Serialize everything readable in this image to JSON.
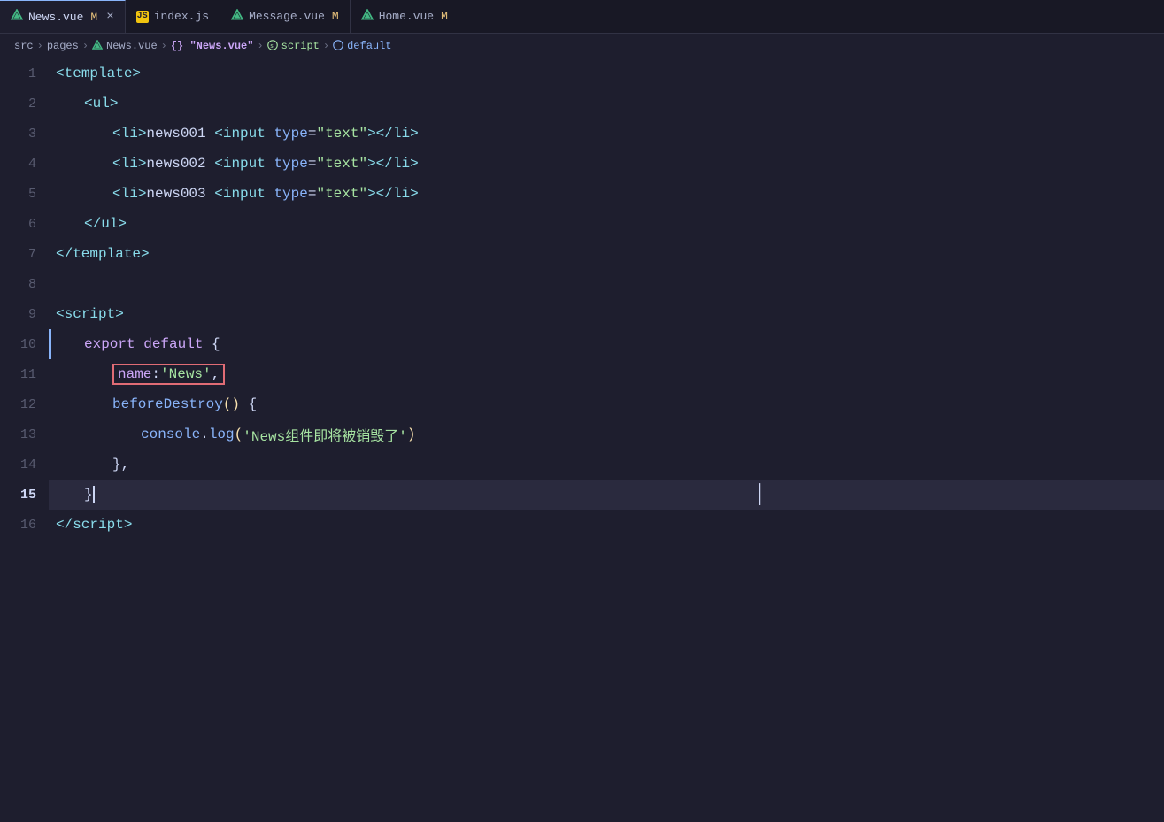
{
  "tabs": [
    {
      "id": "news-vue",
      "label": "News.vue",
      "type": "vue",
      "modified": "M",
      "active": true,
      "hasClose": true
    },
    {
      "id": "index-js",
      "label": "index.js",
      "type": "js",
      "modified": "",
      "active": false,
      "hasClose": false
    },
    {
      "id": "message-vue",
      "label": "Message.vue",
      "type": "vue",
      "modified": "M",
      "active": false,
      "hasClose": false
    },
    {
      "id": "home-vue",
      "label": "Home.vue",
      "type": "vue",
      "modified": "M",
      "active": false,
      "hasClose": false
    }
  ],
  "breadcrumb": {
    "parts": [
      {
        "text": "src",
        "type": "plain"
      },
      {
        "text": ">",
        "type": "sep"
      },
      {
        "text": "pages",
        "type": "plain"
      },
      {
        "text": ">",
        "type": "sep"
      },
      {
        "text": "News.vue",
        "type": "vue"
      },
      {
        "text": ">",
        "type": "sep"
      },
      {
        "text": "{} \"News.vue\"",
        "type": "curly"
      },
      {
        "text": ">",
        "type": "sep"
      },
      {
        "text": "script",
        "type": "script"
      },
      {
        "text": ">",
        "type": "sep"
      },
      {
        "text": "default",
        "type": "highlight"
      }
    ]
  },
  "code_lines": [
    {
      "num": 1,
      "content": "template_open"
    },
    {
      "num": 2,
      "content": "ul_open"
    },
    {
      "num": 3,
      "content": "li_news001"
    },
    {
      "num": 4,
      "content": "li_news002"
    },
    {
      "num": 5,
      "content": "li_news003"
    },
    {
      "num": 6,
      "content": "ul_close"
    },
    {
      "num": 7,
      "content": "template_close"
    },
    {
      "num": 8,
      "content": "empty"
    },
    {
      "num": 9,
      "content": "script_open"
    },
    {
      "num": 10,
      "content": "export_default"
    },
    {
      "num": 11,
      "content": "name_news"
    },
    {
      "num": 12,
      "content": "beforeDestroy"
    },
    {
      "num": 13,
      "content": "console_log"
    },
    {
      "num": 14,
      "content": "close_brace_comma"
    },
    {
      "num": 15,
      "content": "close_brace_cursor"
    },
    {
      "num": 16,
      "content": "script_close"
    }
  ],
  "i_beam_visible": true,
  "detected_highlight": "name : News"
}
